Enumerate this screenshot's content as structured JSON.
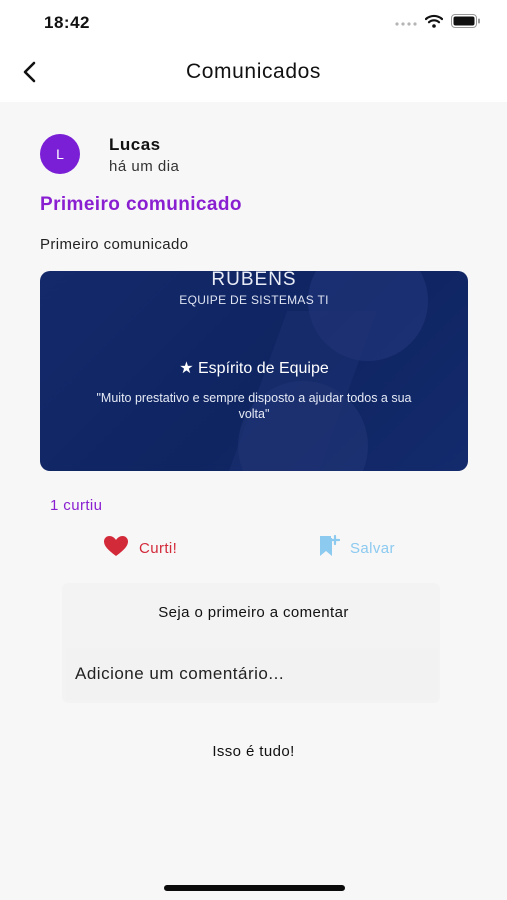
{
  "status_bar": {
    "time": "18:42",
    "icons": [
      "signal-dots-icon",
      "wifi-icon",
      "battery-icon"
    ]
  },
  "nav": {
    "title": "Comunicados",
    "back_icon": "chevron-left-icon"
  },
  "post": {
    "avatar_letter": "L",
    "author": "Lucas",
    "time_ago": "há um dia",
    "title": "Primeiro comunicado",
    "body": "Primeiro comunicado",
    "image": {
      "name": "RUBENS",
      "team": "EQUIPE DE SISTEMAS TI",
      "award": "★ Espírito de Equipe",
      "quote": "\"Muito prestativo e sempre disposto a ajudar todos a sua volta\""
    },
    "likes_count": "1 curtiu"
  },
  "actions": {
    "like_label": "Curti!",
    "save_label": "Salvar"
  },
  "comments": {
    "empty_message": "Seja o primeiro a comentar",
    "input_placeholder": "Adicione um comentário..."
  },
  "footer": {
    "end_text": "Isso é tudo!"
  },
  "colors": {
    "accent_purple": "#8a1fd1",
    "avatar_purple": "#7a1fd6",
    "like_red": "#d32a3a",
    "save_blue": "#8ccaf0",
    "image_navy": "#13296a"
  }
}
